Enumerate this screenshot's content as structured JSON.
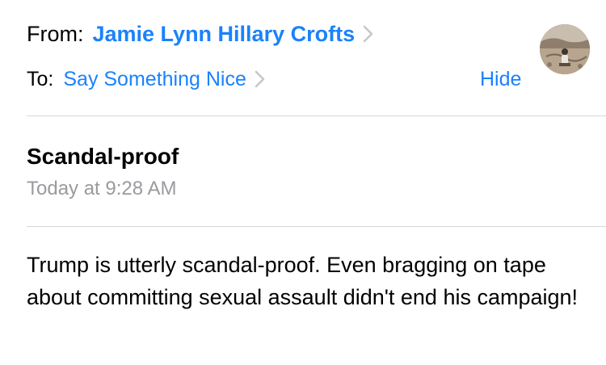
{
  "header": {
    "from_label": "From:",
    "from_name": "Jamie Lynn Hillary Crofts",
    "to_label": "To:",
    "to_name": "Say Something Nice",
    "hide_label": "Hide",
    "avatar_icon": "avatar-photo"
  },
  "message": {
    "subject": "Scandal-proof",
    "date": "Today at 9:28 AM",
    "body": "Trump is utterly scandal-proof. Even bragging on tape about committing sexual assault didn't end his campaign!"
  },
  "colors": {
    "link": "#1a82fb",
    "secondary_text": "#9a9a9f",
    "divider": "#d6d6d6"
  }
}
